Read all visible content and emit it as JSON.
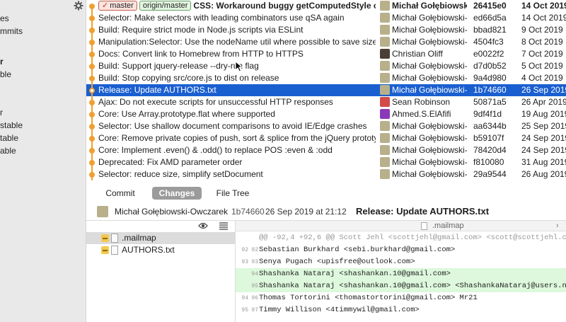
{
  "sidebar": {
    "items": [
      "es",
      "mmits",
      "r",
      "ble",
      "r",
      "stable",
      "table",
      "able"
    ]
  },
  "commits": [
    {
      "refs": [
        {
          "label": "master",
          "type": "local",
          "check": "✓"
        },
        {
          "label": "origin/master",
          "type": "remote"
        }
      ],
      "subject": "CSS: Workaround buggy getComputedStyle on ta…",
      "author": "Michał Gołębiowski-…",
      "sha": "26415e0",
      "date": "14 Oct 2019",
      "bold": true,
      "avatar": "default"
    },
    {
      "subject": "Selector: Make selectors with leading combinators use qSA again",
      "author": "Michał Gołębiowski-…",
      "sha": "ed66d5a",
      "date": "14 Oct 2019",
      "avatar": "default"
    },
    {
      "subject": "Build: Require strict mode in Node.js scripts via ESLint",
      "author": "Michał Gołębiowski-…",
      "sha": "bbad821",
      "date": "9 Oct 2019",
      "avatar": "default"
    },
    {
      "subject": "Manipulation:Selector: Use the nodeName util where possible to save size",
      "author": "Michał Gołębiowski-…",
      "sha": "4504fc3",
      "date": "8 Oct 2019",
      "avatar": "default"
    },
    {
      "subject": "Docs: Convert link to Homebrew from HTTP to HTTPS",
      "author": "Christian Oliff",
      "sha": "e0022f2",
      "date": "7 Oct 2019",
      "avatar": "dark"
    },
    {
      "subject": "Build: Support jquery-release --dry-run flag",
      "author": "Michał Gołębiowski-…",
      "sha": "d7d0b52",
      "date": "5 Oct 2019",
      "avatar": "default"
    },
    {
      "subject": "Build: Stop copying src/core.js to dist on release",
      "author": "Michał Gołębiowski-…",
      "sha": "9a4d980",
      "date": "4 Oct 2019",
      "avatar": "default"
    },
    {
      "subject": "Release: Update AUTHORS.txt",
      "author": "Michał Gołębiowski-…",
      "sha": "1b74660",
      "date": "26 Sep 2019",
      "selected": true,
      "avatar": "default"
    },
    {
      "subject": "Ajax: Do not execute scripts for unsuccessful HTTP responses",
      "author": "Sean Robinson",
      "sha": "50871a5",
      "date": "26 Apr 2019",
      "avatar": "red"
    },
    {
      "subject": "Core: Use Array.prototype.flat where supported",
      "author": "Ahmed.S.ElAfifi",
      "sha": "9df4f1d",
      "date": "19 Aug 2019",
      "avatar": "purple"
    },
    {
      "subject": "Selector: Use shallow document comparisons to avoid IE/Edge crashes",
      "author": "Michał Gołębiowski-…",
      "sha": "aa6344b",
      "date": "25 Sep 2019",
      "avatar": "default"
    },
    {
      "subject": "Core: Remove private copies of push, sort & splice from the jQuery prototype",
      "author": "Michał Gołębiowski-…",
      "sha": "b59107f",
      "date": "24 Sep 2019",
      "avatar": "default"
    },
    {
      "subject": "Core: Implement .even() & .odd() to replace POS :even & :odd",
      "author": "Michał Gołębiowski-…",
      "sha": "78420d4",
      "date": "24 Sep 2019",
      "avatar": "default"
    },
    {
      "subject": "Deprecated: Fix AMD parameter order",
      "author": "Michał Gołębiowski-…",
      "sha": "f810080",
      "date": "31 Aug 2019",
      "avatar": "default"
    },
    {
      "subject": "Selector: reduce size, simplify setDocument",
      "author": "Michał Gołębiowski-…",
      "sha": "29a9544",
      "date": "26 Aug 2019",
      "avatar": "default"
    }
  ],
  "tabs": [
    {
      "label": "Commit",
      "active": false
    },
    {
      "label": "Changes",
      "active": true
    },
    {
      "label": "File Tree",
      "active": false
    }
  ],
  "commit_header": {
    "author": "Michał Gołębiowski-Owczarek",
    "sha": "1b74660",
    "datetime": "26 Sep 2019 at 21:12",
    "title": "Release: Update AUTHORS.txt"
  },
  "files": [
    {
      "name": ".mailmap",
      "selected": true
    },
    {
      "name": "AUTHORS.txt",
      "selected": false
    }
  ],
  "diff": {
    "filename": ".mailmap",
    "lines": [
      {
        "type": "hunk",
        "old": "",
        "new": "",
        "text": "@@ -92,4 +92,6 @@ Scott Jehl <scottjehl@gmail.com> <scott@scottjehl.com>"
      },
      {
        "type": "ctx",
        "old": "92",
        "new": "92",
        "text": "Sebastian Burkhard <sebi.burkhard@gmail.com>"
      },
      {
        "type": "ctx",
        "old": "93",
        "new": "93",
        "text": "Senya Pugach <upisfree@outlook.com>"
      },
      {
        "type": "add",
        "old": "",
        "new": "94",
        "text": "Shashanka Nataraj <shashankan.10@gmail.com>"
      },
      {
        "type": "add",
        "old": "",
        "new": "95",
        "text": "Shashanka Nataraj <shashankan.10@gmail.com> <ShashankaNataraj@users.noreply.g"
      },
      {
        "type": "ctx",
        "old": "94",
        "new": "96",
        "text": "Thomas Tortorini <thomastortorini@gmail.com> Mr21"
      },
      {
        "type": "ctx",
        "old": "95",
        "new": "97",
        "text": "Timmy Willison <4timmywil@gmail.com>"
      }
    ]
  },
  "colors": {
    "selection": "#1a5fd0",
    "graph": "#f0a030",
    "added_line": "#ddf8dc"
  }
}
